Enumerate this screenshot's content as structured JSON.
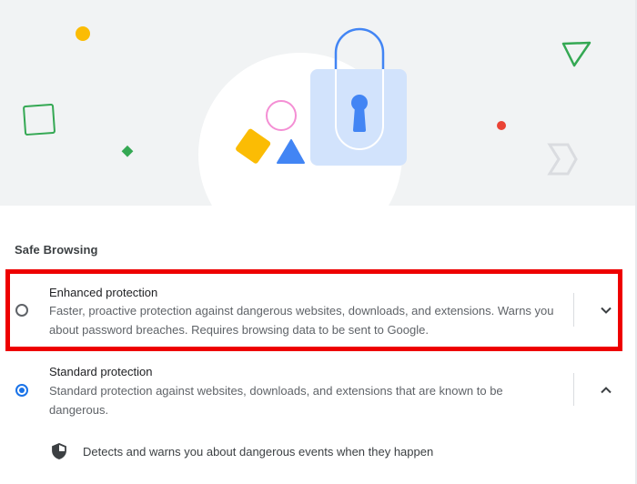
{
  "section": {
    "title": "Safe Browsing"
  },
  "options": [
    {
      "title": "Enhanced protection",
      "description": "Faster, proactive protection against dangerous websites, downloads, and extensions. Warns you about password breaches. Requires browsing data to be sent to Google.",
      "selected": false,
      "expand_icon": "chevron-down-icon"
    },
    {
      "title": "Standard protection",
      "description": "Standard protection against websites, downloads, and extensions that are known to be dangerous.",
      "selected": true,
      "expand_icon": "chevron-up-icon"
    }
  ],
  "standard_details": [
    {
      "icon": "shield-icon",
      "text": "Detects and warns you about dangerous events when they happen"
    }
  ],
  "colors": {
    "accent_blue": "#1a73e8",
    "highlight_red": "#ee0000",
    "lock_blue": "#4285f4",
    "yellow": "#fbbc04",
    "green": "#34a853",
    "red": "#ea4335",
    "pink": "#f48fd4"
  }
}
